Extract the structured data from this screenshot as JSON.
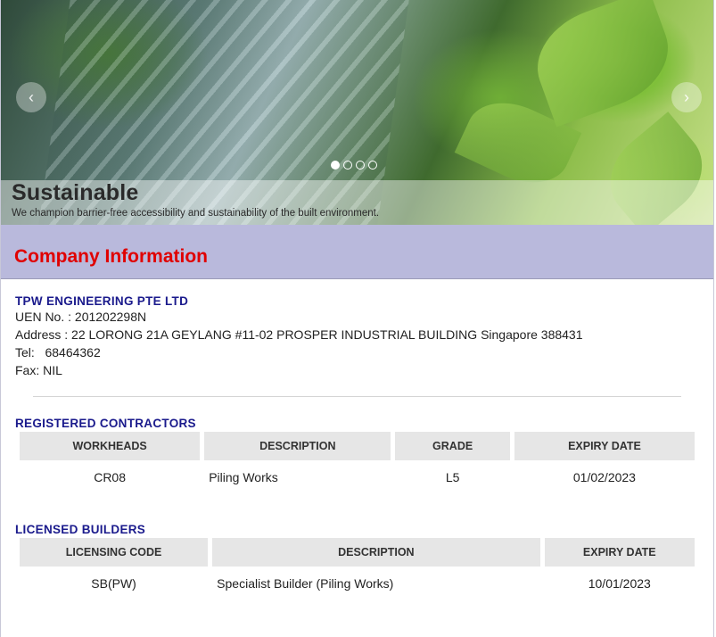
{
  "hero": {
    "title": "Sustainable",
    "subtitle": "We champion barrier-free accessibility and sustainability of the built environment.",
    "prev_icon": "chevron-left-icon",
    "next_icon": "chevron-right-icon",
    "slides": 4,
    "active_slide": 1
  },
  "section": {
    "title": "Company Information"
  },
  "company": {
    "name": "TPW ENGINEERING PTE LTD",
    "uen": "UEN No. : 201202298N",
    "address": "Address : 22 LORONG 21A GEYLANG #11-02 PROSPER INDUSTRIAL BUILDING Singapore 388431",
    "tel": "Tel:   68464362",
    "fax": "Fax: NIL"
  },
  "registered_contractors": {
    "heading": "REGISTERED CONTRACTORS",
    "columns": [
      "WORKHEADS",
      "DESCRIPTION",
      "GRADE",
      "EXPIRY DATE"
    ],
    "rows": [
      [
        "CR08",
        "Piling Works",
        "L5",
        "01/02/2023"
      ]
    ]
  },
  "licensed_builders": {
    "heading": "LICENSED BUILDERS",
    "columns": [
      "LICENSING CODE",
      "DESCRIPTION",
      "EXPIRY DATE"
    ],
    "rows": [
      [
        "SB(PW)",
        "Specialist Builder (Piling Works)",
        "10/01/2023"
      ]
    ]
  },
  "colors": {
    "section_band": "#b9b9dc",
    "section_title": "#e00000",
    "heading_navy": "#1a1a8c",
    "table_header_bg": "#e6e6e6"
  }
}
